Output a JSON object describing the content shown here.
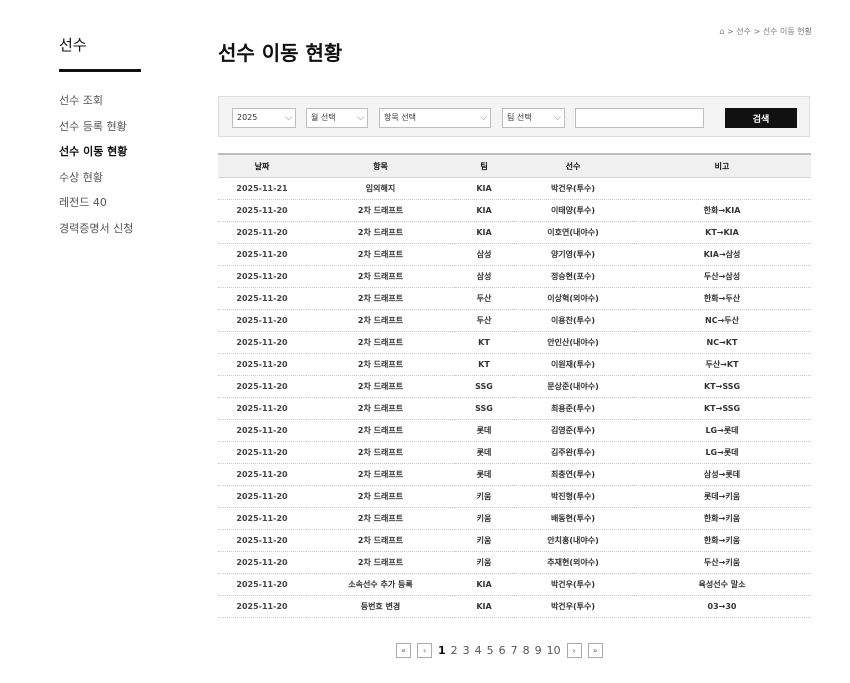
{
  "sidebar": {
    "title": "선수",
    "items": [
      {
        "label": "선수 조회",
        "active": false
      },
      {
        "label": "선수 등록 현황",
        "active": false
      },
      {
        "label": "선수 이동 현황",
        "active": true
      },
      {
        "label": "수상 현황",
        "active": false
      },
      {
        "label": "레전드 40",
        "active": false
      },
      {
        "label": "경력증명서 신청",
        "active": false
      }
    ]
  },
  "breadcrumb": {
    "home_icon": "⌂",
    "sep": ">",
    "items": [
      "선수",
      "선수 이동 현황"
    ]
  },
  "page": {
    "title": "선수 이동 현황"
  },
  "search": {
    "year": "2025",
    "month_placeholder": "월 선택",
    "category_placeholder": "항목 선택",
    "team_placeholder": "팀 선택",
    "keyword_value": "",
    "button_label": "검색"
  },
  "table": {
    "headers": [
      "날짜",
      "항목",
      "팀",
      "선수",
      "비고"
    ],
    "rows": [
      [
        "2025-11-21",
        "임의해지",
        "KIA",
        "박건우(투수)",
        ""
      ],
      [
        "2025-11-20",
        "2차 드래프트",
        "KIA",
        "이태양(투수)",
        "한화→KIA"
      ],
      [
        "2025-11-20",
        "2차 드래프트",
        "KIA",
        "이호연(내야수)",
        "KT→KIA"
      ],
      [
        "2025-11-20",
        "2차 드래프트",
        "삼성",
        "양기영(투수)",
        "KIA→삼성"
      ],
      [
        "2025-11-20",
        "2차 드래프트",
        "삼성",
        "정승현(포수)",
        "두산→삼성"
      ],
      [
        "2025-11-20",
        "2차 드래프트",
        "두산",
        "이상혁(외야수)",
        "한화→두산"
      ],
      [
        "2025-11-20",
        "2차 드래프트",
        "두산",
        "이용찬(투수)",
        "NC→두산"
      ],
      [
        "2025-11-20",
        "2차 드래프트",
        "KT",
        "안인산(내야수)",
        "NC→KT"
      ],
      [
        "2025-11-20",
        "2차 드래프트",
        "KT",
        "이원재(투수)",
        "두산→KT"
      ],
      [
        "2025-11-20",
        "2차 드래프트",
        "SSG",
        "문상준(내야수)",
        "KT→SSG"
      ],
      [
        "2025-11-20",
        "2차 드래프트",
        "SSG",
        "최용준(투수)",
        "KT→SSG"
      ],
      [
        "2025-11-20",
        "2차 드래프트",
        "롯데",
        "김영준(투수)",
        "LG→롯데"
      ],
      [
        "2025-11-20",
        "2차 드래프트",
        "롯데",
        "김주완(투수)",
        "LG→롯데"
      ],
      [
        "2025-11-20",
        "2차 드래프트",
        "롯데",
        "최충연(투수)",
        "삼성→롯데"
      ],
      [
        "2025-11-20",
        "2차 드래프트",
        "키움",
        "박진형(투수)",
        "롯데→키움"
      ],
      [
        "2025-11-20",
        "2차 드래프트",
        "키움",
        "배동현(투수)",
        "한화→키움"
      ],
      [
        "2025-11-20",
        "2차 드래프트",
        "키움",
        "안치홍(내야수)",
        "한화→키움"
      ],
      [
        "2025-11-20",
        "2차 드래프트",
        "키움",
        "추재현(외야수)",
        "두산→키움"
      ],
      [
        "2025-11-20",
        "소속선수 추가 등록",
        "KIA",
        "박건우(투수)",
        "육성선수 말소"
      ],
      [
        "2025-11-20",
        "등번호 변경",
        "KIA",
        "박건우(투수)",
        "03→30"
      ]
    ]
  },
  "pagination": {
    "first": "«",
    "prev": "‹",
    "pages": [
      "1",
      "2",
      "3",
      "4",
      "5",
      "6",
      "7",
      "8",
      "9",
      "10"
    ],
    "current": "1",
    "next": "›",
    "last": "»"
  }
}
